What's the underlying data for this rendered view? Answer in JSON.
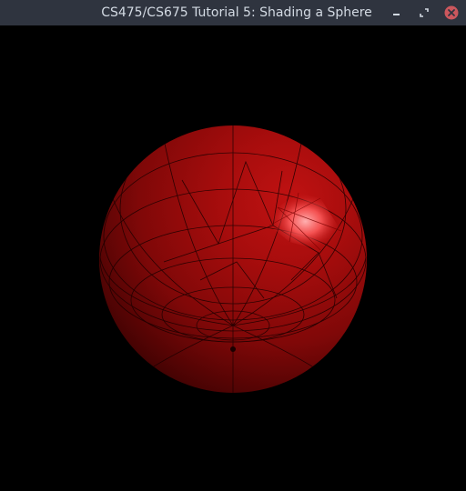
{
  "window": {
    "title": "CS475/CS675 Tutorial 5: Shading a Sphere"
  },
  "controls": {
    "minimize_icon": "minimize-icon",
    "maximize_icon": "maximize-icon",
    "close_icon": "close-icon"
  },
  "colors": {
    "titlebar_bg": "#2f343f",
    "title_text": "#d3dae3",
    "close_button": "#cc575d",
    "canvas_bg": "#000000",
    "sphere_base": "#8b0b0b",
    "sphere_highlight": "#ff6a6a"
  }
}
